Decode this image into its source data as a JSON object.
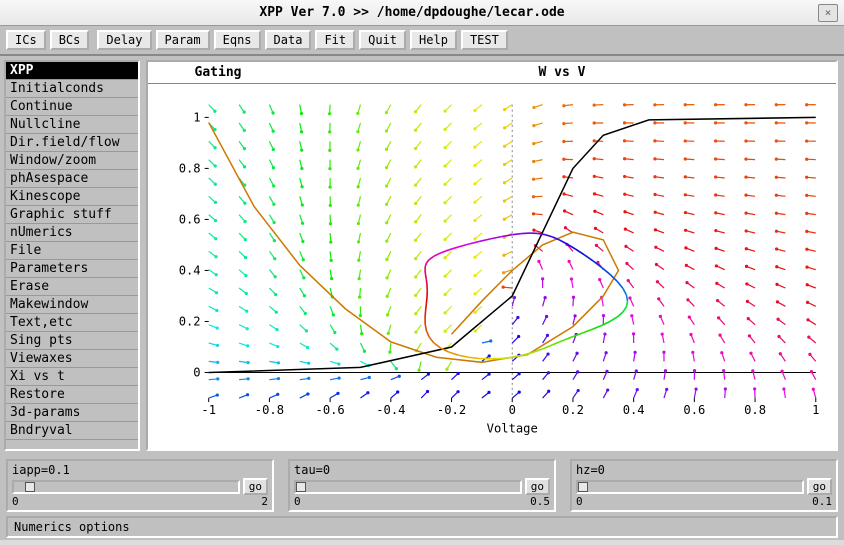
{
  "window": {
    "title": "XPP Ver 7.0 >> /home/dpdoughe/lecar.ode",
    "close_label": "×"
  },
  "toolbar": {
    "ics": "ICs",
    "bcs": "BCs",
    "delay": "Delay",
    "param": "Param",
    "eqns": "Eqns",
    "data": "Data",
    "fit": "Fit",
    "quit": "Quit",
    "help": "Help",
    "test": "TEST"
  },
  "sidebar": {
    "items": [
      {
        "label": "XPP",
        "selected": true
      },
      {
        "label": "Initialconds"
      },
      {
        "label": "Continue"
      },
      {
        "label": "Nullcline"
      },
      {
        "label": "Dir.field/flow"
      },
      {
        "label": "Window/zoom"
      },
      {
        "label": "phAsespace"
      },
      {
        "label": "Kinescope"
      },
      {
        "label": "Graphic stuff"
      },
      {
        "label": "nUmerics"
      },
      {
        "label": "File"
      },
      {
        "label": "Parameters"
      },
      {
        "label": "Erase"
      },
      {
        "label": "Makewindow"
      },
      {
        "label": "Text,etc"
      },
      {
        "label": "Sing pts"
      },
      {
        "label": "Viewaxes"
      },
      {
        "label": "Xi vs t"
      },
      {
        "label": "Restore"
      },
      {
        "label": "3d-params"
      },
      {
        "label": "Bndryval"
      }
    ]
  },
  "plot": {
    "gating": "Gating",
    "title": "W vs V",
    "xlabel": "Voltage"
  },
  "chart_data": {
    "type": "vector-field-phase-plane",
    "title": "W vs V",
    "xlabel": "Voltage",
    "ylabel": "",
    "xlim": [
      -1,
      1
    ],
    "ylim": [
      -0.1,
      1.05
    ],
    "xticks": [
      -1,
      -0.8,
      -0.6,
      -0.4,
      -0.2,
      0,
      0.2,
      0.4,
      0.6,
      0.8,
      1
    ],
    "yticks": [
      0,
      0.2,
      0.4,
      0.6,
      0.8,
      1
    ],
    "vector_field": {
      "grid_spacing_x": 0.1,
      "grid_spacing_y": 0.07,
      "color_scheme": "direction-based rainbow (blue=up-right through orange=down-left)"
    },
    "nullclines": [
      {
        "name": "V-nullcline",
        "color": "#cc7a00",
        "approx_points": [
          [
            -1,
            0.98
          ],
          [
            -0.85,
            0.65
          ],
          [
            -0.7,
            0.42
          ],
          [
            -0.55,
            0.25
          ],
          [
            -0.4,
            0.12
          ],
          [
            -0.25,
            0.06
          ],
          [
            -0.1,
            0.04
          ],
          [
            0.05,
            0.07
          ],
          [
            0.2,
            0.18
          ],
          [
            0.3,
            0.3
          ],
          [
            0.35,
            0.4
          ],
          [
            0.3,
            0.52
          ],
          [
            0.2,
            0.55
          ],
          [
            0.1,
            0.5
          ],
          [
            0.0,
            0.4
          ],
          [
            -0.1,
            0.28
          ],
          [
            -0.2,
            0.15
          ]
        ]
      },
      {
        "name": "W-nullcline",
        "color": "#000000",
        "approx_points": [
          [
            -1,
            0
          ],
          [
            -0.5,
            0.02
          ],
          [
            -0.2,
            0.1
          ],
          [
            0,
            0.3
          ],
          [
            0.1,
            0.55
          ],
          [
            0.2,
            0.8
          ],
          [
            0.3,
            0.93
          ],
          [
            0.45,
            0.99
          ],
          [
            1,
            1
          ]
        ]
      }
    ],
    "trajectories": [
      {
        "color_gradient": "rainbow",
        "description": "limit cycle orbit approx bounding box",
        "x_range": [
          -0.35,
          0.4
        ],
        "y_range": [
          0.03,
          0.55
        ]
      }
    ],
    "fixed_points": [
      {
        "x": 0.0,
        "y": 0.3,
        "type": "unstable"
      }
    ]
  },
  "sliders": [
    {
      "label": "iapp=0.1",
      "min": "0",
      "max": "2",
      "go": "go",
      "pos": 0.05
    },
    {
      "label": "tau=0",
      "min": "0",
      "max": "0.5",
      "go": "go",
      "pos": 0
    },
    {
      "label": "hz=0",
      "min": "0",
      "max": "0.1",
      "go": "go",
      "pos": 0
    }
  ],
  "status": {
    "text": "Numerics options"
  }
}
